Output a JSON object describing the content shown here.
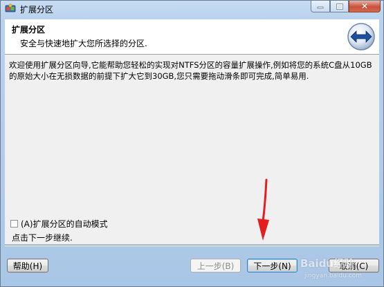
{
  "window": {
    "title": "扩展分区"
  },
  "header": {
    "title": "扩展分区",
    "subtitle": "安全与快速地扩大您所选择的分区."
  },
  "content": {
    "description": "欢迎使用扩展分区向导,它能帮助您轻松的实现对NTFS分区的容量扩展操作,例如将您的系统C盘从10GB的原始大小在无损数据的前提下扩大它到30GB,您只需要拖动滑条即可完成,简单易用.",
    "auto_mode_label": "(A)扩展分区的自动模式",
    "auto_mode_checked": false,
    "hint": "点击下一步继续."
  },
  "buttons": {
    "help": "帮助(H)",
    "back": "上一步(B)",
    "next": "下一步(N)",
    "cancel": "取消(C)"
  },
  "watermark": {
    "brand": "Baidu经验",
    "url": "jingyan.baidu.com"
  },
  "icons": {
    "app": "partition-app-icon",
    "wizard_logo": "resize-arrows-icon",
    "annotation": "red-arrow-pointer-icon"
  },
  "colors": {
    "window_frame": "#aac6e6",
    "content_bg": "#f0f0f0",
    "arrow_red": "#e41e1e",
    "logo_blue": "#1e4f9a"
  }
}
